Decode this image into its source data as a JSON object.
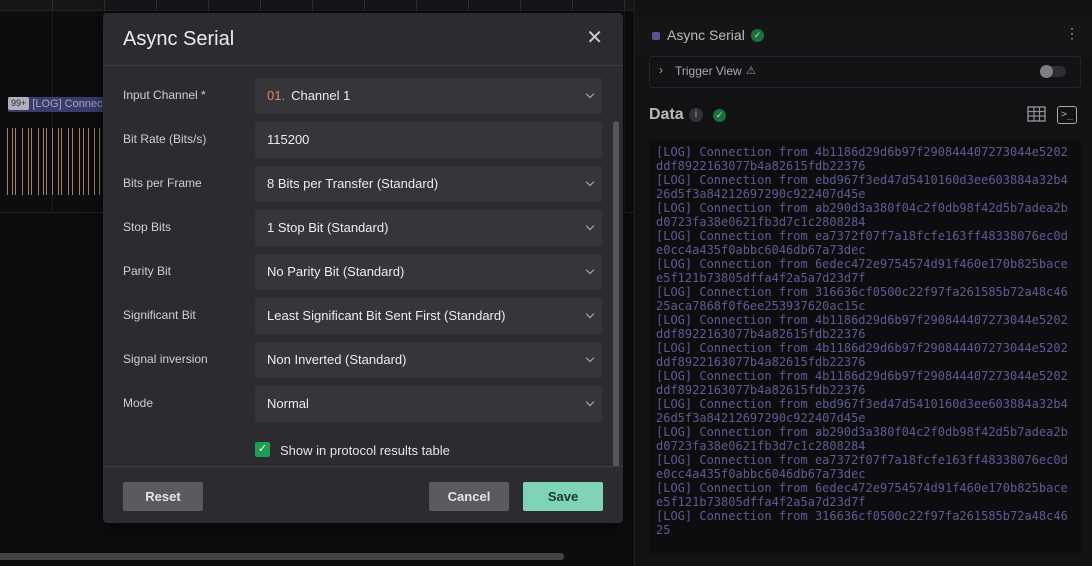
{
  "waveform": {
    "badge_count": "99+",
    "badge_text": "[LOG] Connec"
  },
  "analyzer": {
    "name": "Async Serial",
    "trigger_view_label": "Trigger View",
    "trigger_view_enabled": false
  },
  "data_panel": {
    "title": "Data",
    "log_lines": [
      "[LOG] Connection from 4b1186d29d6b97f290844407273044e5202ddf8922163077b4a82615fdb22376",
      "[LOG] Connection from ebd967f3ed47d5410160d3ee603884a32b426d5f3a84212697290c922407d45e",
      "[LOG] Connection from ab290d3a380f04c2f0db98f42d5b7adea2bd0723fa38e0621fb3d7c1c2808284",
      "[LOG] Connection from ea7372f07f7a18fcfe163ff48338076ec0de0cc4a435f0abbc6046db67a73dec",
      "[LOG] Connection from 6edec472e9754574d91f460e170b825bacee5f121b73805dffa4f2a5a7d23d7f",
      "[LOG] Connection from 316636cf0500c22f97fa261585b72a48c4625aca7868f0f6ee253937620ac15c",
      "[LOG] Connection from 4b1186d29d6b97f290844407273044e5202ddf8922163077b4a82615fdb22376",
      "[LOG] Connection from 4b1186d29d6b97f290844407273044e5202ddf8922163077b4a82615fdb22376",
      "[LOG] Connection from 4b1186d29d6b97f290844407273044e5202ddf8922163077b4a82615fdb22376",
      "[LOG] Connection from ebd967f3ed47d5410160d3ee603884a32b426d5f3a84212697290c922407d45e",
      "[LOG] Connection from ab290d3a380f04c2f0db98f42d5b7adea2bd0723fa38e0621fb3d7c1c2808284",
      "[LOG] Connection from ea7372f07f7a18fcfe163ff48338076ec0de0cc4a435f0abbc6046db67a73dec",
      "[LOG] Connection from 6edec472e9754574d91f460e170b825bacee5f121b73805dffa4f2a5a7d23d7f",
      "[LOG] Connection from 316636cf0500c22f97fa261585b72a48c4625"
    ]
  },
  "modal": {
    "title": "Async Serial",
    "fields": [
      {
        "label": "Input Channel *",
        "prefix": "01.",
        "value": "Channel 1",
        "type": "select"
      },
      {
        "label": "Bit Rate (Bits/s)",
        "value": "115200",
        "type": "text"
      },
      {
        "label": "Bits per Frame",
        "value": "8 Bits per Transfer (Standard)",
        "type": "select"
      },
      {
        "label": "Stop Bits",
        "value": "1 Stop Bit (Standard)",
        "type": "select"
      },
      {
        "label": "Parity Bit",
        "value": "No Parity Bit (Standard)",
        "type": "select"
      },
      {
        "label": "Significant Bit",
        "value": "Least Significant Bit Sent First (Standard)",
        "type": "select"
      },
      {
        "label": "Signal inversion",
        "value": "Non Inverted (Standard)",
        "type": "select"
      },
      {
        "label": "Mode",
        "value": "Normal",
        "type": "select"
      }
    ],
    "show_in_table_label": "Show in protocol results table",
    "show_in_table_checked": true,
    "reset_label": "Reset",
    "cancel_label": "Cancel",
    "save_label": "Save"
  },
  "colors": {
    "save_accent": "#7fd3b6",
    "status_ok": "#1f8a4c",
    "log_text": "#7070b4",
    "channel_prefix": "#e08a68"
  },
  "icons": {
    "close": "close-icon",
    "chevron": "chevron-down-icon",
    "trigger_expand": "chevron-right-icon",
    "warning": "warning-icon",
    "info": "info-icon",
    "check": "check-circle-icon",
    "table": "table-icon",
    "terminal": "terminal-icon",
    "kebab": "kebab-menu-icon"
  }
}
